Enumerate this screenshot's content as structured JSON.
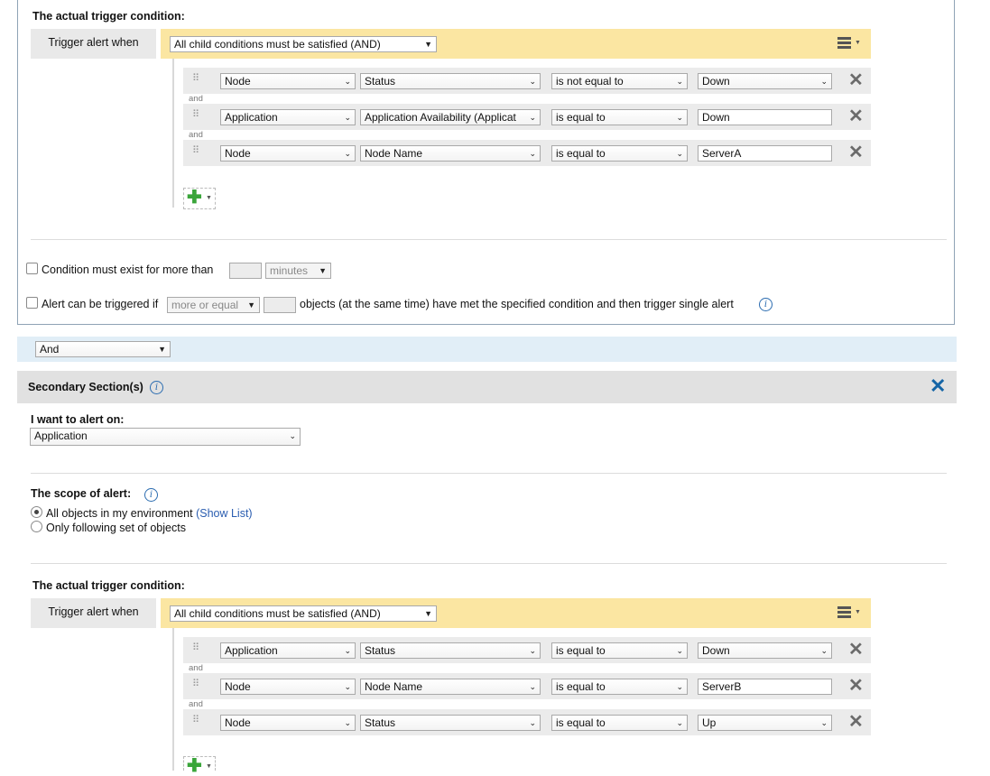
{
  "primary": {
    "trigger_title": "The actual trigger condition:",
    "trigger_label": "Trigger alert when",
    "group_select": "All child conditions must be satisfied (AND)",
    "and_label": "and",
    "conditions": [
      {
        "field": "Node",
        "property": "Status",
        "operator": "is not equal to",
        "value": "Down",
        "value_type": "select"
      },
      {
        "field": "Application",
        "property": "Application Availability (Applicat",
        "operator": "is equal to",
        "value": "Down",
        "value_type": "text"
      },
      {
        "field": "Node",
        "property": "Node Name",
        "operator": "is equal to",
        "value": "ServerA",
        "value_type": "text"
      }
    ],
    "condition_exist_label": "Condition must exist for more than",
    "condition_exist_value": "",
    "condition_exist_unit": "minutes",
    "alert_triggered_label": "Alert can be triggered if",
    "alert_triggered_select": "more or equal",
    "alert_triggered_count": "",
    "alert_triggered_suffix": "objects (at the same time) have met the specified condition and then trigger single alert"
  },
  "joiner": {
    "value": "And"
  },
  "secondary": {
    "title": "Secondary Section(s)",
    "alert_on_label": "I want to alert on:",
    "alert_on_value": "Application",
    "scope_label": "The scope of alert:",
    "scope_options": [
      {
        "label": "All objects in my environment",
        "link": "(Show List)",
        "selected": true
      },
      {
        "label": "Only following set of objects",
        "link": "",
        "selected": false
      }
    ],
    "trigger_title": "The actual trigger condition:",
    "trigger_label": "Trigger alert when",
    "group_select": "All child conditions must be satisfied (AND)",
    "and_label": "and",
    "conditions": [
      {
        "field": "Application",
        "property": "Status",
        "operator": "is equal to",
        "value": "Down",
        "value_type": "select"
      },
      {
        "field": "Node",
        "property": "Node Name",
        "operator": "is equal to",
        "value": "ServerB",
        "value_type": "text"
      },
      {
        "field": "Node",
        "property": "Status",
        "operator": "is equal to",
        "value": "Up",
        "value_type": "select"
      }
    ]
  },
  "icons": {
    "close": "close-icon",
    "menu": "menu-icon",
    "add": "add-icon",
    "info": "info-icon",
    "drag": "drag-handle-icon"
  },
  "colors": {
    "trigger_bar": "#fbe6a2",
    "section_header": "#e1e1e1",
    "joiner_bar": "#e1eef7",
    "close_blue": "#1565a6",
    "add_green": "#3aa53a"
  }
}
